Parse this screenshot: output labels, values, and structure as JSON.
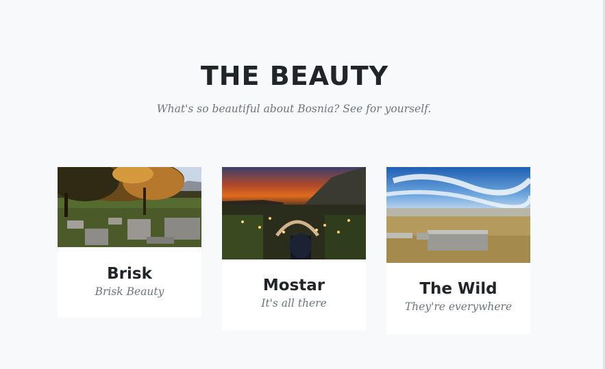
{
  "section": {
    "title": "THE BEAUTY",
    "subtitle": "What's so beautiful about Bosnia? See for yourself."
  },
  "cards": [
    {
      "title": "Brisk",
      "subtitle": "Brisk Beauty",
      "image": "stone-tombs-autumn-forest-photo"
    },
    {
      "title": "Mostar",
      "subtitle": "It's all there",
      "image": "mostar-bridge-night-photo"
    },
    {
      "title": "The Wild",
      "subtitle": "They're everywhere",
      "image": "stone-tomb-meadow-sky-photo"
    }
  ]
}
